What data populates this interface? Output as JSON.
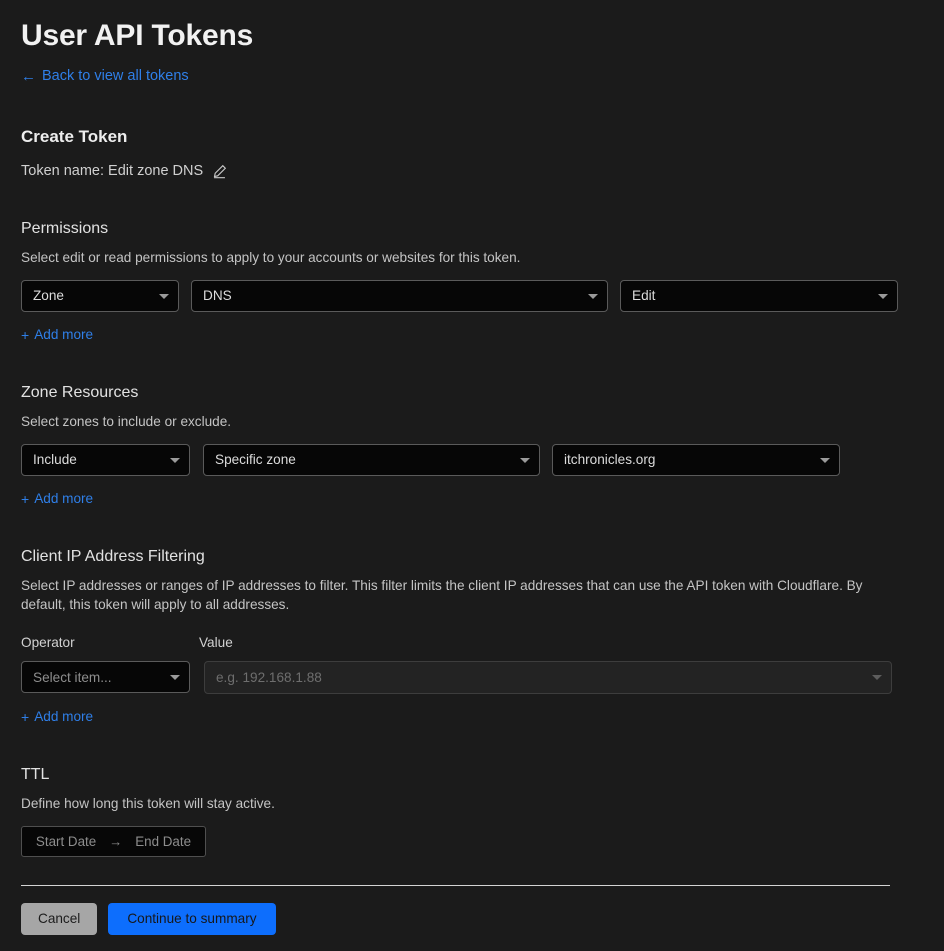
{
  "header": {
    "title": "User API Tokens",
    "back_link": "Back to view all tokens",
    "back_arrow": "←"
  },
  "create_token": {
    "heading": "Create Token",
    "token_name_label": "Token name: Edit zone DNS",
    "edit_icon": "pencil-icon"
  },
  "permissions": {
    "heading": "Permissions",
    "description": "Select edit or read permissions to apply to your accounts or websites for this token.",
    "scope_value": "Zone",
    "resource_value": "DNS",
    "access_value": "Edit",
    "add_more": "Add more",
    "add_more_plus": "+"
  },
  "zone_resources": {
    "heading": "Zone Resources",
    "description": "Select zones to include or exclude.",
    "inclusion_value": "Include",
    "scope_value": "Specific zone",
    "zone_value": "itchronicles.org",
    "add_more": "Add more",
    "add_more_plus": "+"
  },
  "client_ip_filtering": {
    "heading": "Client IP Address Filtering",
    "description": "Select IP addresses or ranges of IP addresses to filter. This filter limits the client IP addresses that can use the API token with Cloudflare. By default, this token will apply to all addresses.",
    "operator_label": "Operator",
    "value_label": "Value",
    "operator_value": "Select item...",
    "value_placeholder": "e.g. 192.168.1.88",
    "add_more": "Add more",
    "add_more_plus": "+"
  },
  "ttl": {
    "heading": "TTL",
    "description": "Define how long this token will stay active.",
    "start_date": "Start Date",
    "end_date": "End Date",
    "range_arrow": "→"
  },
  "footer": {
    "cancel_label": "Cancel",
    "continue_label": "Continue to summary"
  },
  "colors": {
    "background": "#1b1b1b",
    "accent_blue": "#2f7fe8",
    "primary_button": "#0d6efd",
    "cancel_button": "#a6a6a6"
  }
}
